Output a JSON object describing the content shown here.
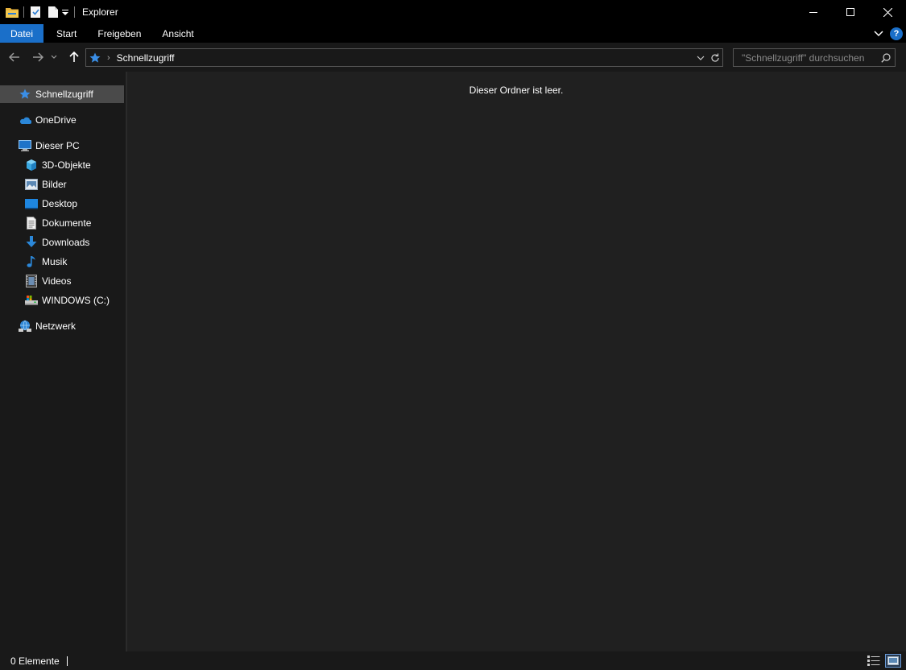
{
  "window": {
    "title": "Explorer"
  },
  "ribbon": {
    "tabs": [
      "Datei",
      "Start",
      "Freigeben",
      "Ansicht"
    ],
    "help_label": "?"
  },
  "address": {
    "breadcrumb": "Schnellzugriff",
    "separator": "›"
  },
  "search": {
    "placeholder": "\"Schnellzugriff\" durchsuchen"
  },
  "sidebar": {
    "items": [
      {
        "label": "Schnellzugriff",
        "icon": "star-icon",
        "selected": true
      },
      {
        "label": "OneDrive",
        "icon": "cloud-icon"
      },
      {
        "label": "Dieser PC",
        "icon": "computer-icon"
      },
      {
        "label": "3D-Objekte",
        "icon": "cube-icon"
      },
      {
        "label": "Bilder",
        "icon": "pictures-icon"
      },
      {
        "label": "Desktop",
        "icon": "desktop-icon"
      },
      {
        "label": "Dokumente",
        "icon": "document-icon"
      },
      {
        "label": "Downloads",
        "icon": "download-icon"
      },
      {
        "label": "Musik",
        "icon": "music-icon"
      },
      {
        "label": "Videos",
        "icon": "video-icon"
      },
      {
        "label": "WINDOWS (C:)",
        "icon": "drive-icon"
      },
      {
        "label": "Netzwerk",
        "icon": "network-icon"
      }
    ]
  },
  "content": {
    "empty_message": "Dieser Ordner ist leer."
  },
  "status": {
    "item_count": "0 Elemente"
  },
  "colors": {
    "accent": "#1a6fc9",
    "background": "#202020",
    "pane": "#191919",
    "selected": "#4a4a4a"
  }
}
